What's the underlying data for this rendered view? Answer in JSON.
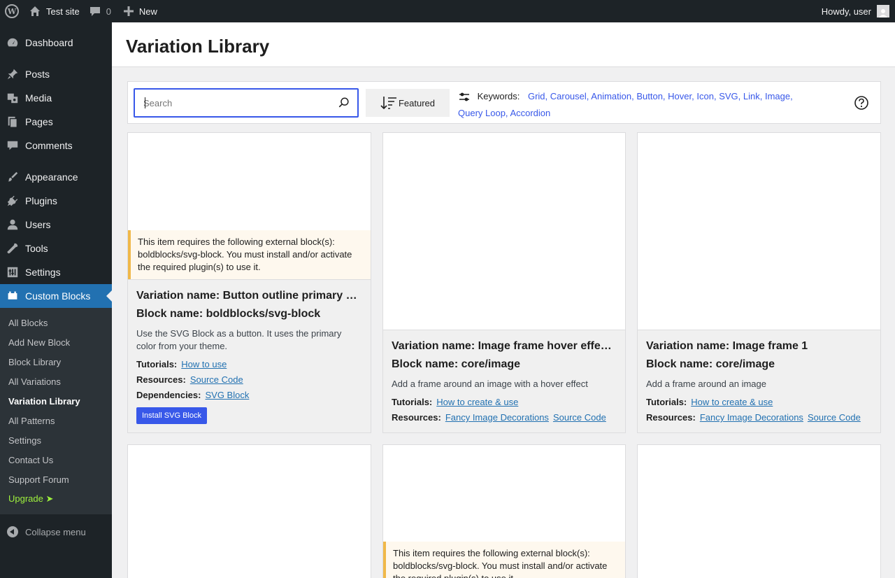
{
  "admin_bar": {
    "site_name": "Test site",
    "comments_count": "0",
    "new_label": "New",
    "greeting": "Howdy, user"
  },
  "sidebar": {
    "menu": [
      {
        "label": "Dashboard",
        "icon": "dashboard-icon"
      },
      {
        "label": "Posts",
        "icon": "pin-icon"
      },
      {
        "label": "Media",
        "icon": "media-icon"
      },
      {
        "label": "Pages",
        "icon": "pages-icon"
      },
      {
        "label": "Comments",
        "icon": "comment-icon"
      },
      {
        "label": "Appearance",
        "icon": "brush-icon"
      },
      {
        "label": "Plugins",
        "icon": "plug-icon"
      },
      {
        "label": "Users",
        "icon": "user-icon"
      },
      {
        "label": "Tools",
        "icon": "wrench-icon"
      },
      {
        "label": "Settings",
        "icon": "sliders-icon"
      },
      {
        "label": "Custom Blocks",
        "icon": "blocks-icon"
      }
    ],
    "submenu": [
      {
        "label": "All Blocks"
      },
      {
        "label": "Add New Block"
      },
      {
        "label": "Block Library"
      },
      {
        "label": "All Variations"
      },
      {
        "label": "Variation Library"
      },
      {
        "label": "All Patterns"
      },
      {
        "label": "Settings"
      },
      {
        "label": "Contact Us"
      },
      {
        "label": "Support Forum"
      },
      {
        "label": "Upgrade ➤"
      }
    ],
    "collapse_label": "Collapse menu"
  },
  "page": {
    "title": "Variation Library"
  },
  "toolbar": {
    "search_placeholder": "Search",
    "sort_label": "Featured",
    "keywords_label": "Keywords:",
    "keywords": [
      "Grid,",
      "Carousel,",
      "Animation,",
      "Button,",
      "Hover,",
      "Icon,",
      "SVG,",
      "Link,",
      "Image,",
      "Query Loop,",
      "Accordion"
    ]
  },
  "cards": [
    {
      "notice": "This item requires the following external block(s): boldblocks/svg-block. You must install and/or activate the required plugin(s) to use it.",
      "variation_name": "Variation name: Button outline primary …",
      "block_name": "Block name: boldblocks/svg-block",
      "description": "Use the SVG Block as a button. It uses the primary color from your theme.",
      "tutorials_label": "Tutorials:",
      "tutorials": [
        "How to use"
      ],
      "resources_label": "Resources:",
      "resources": [
        "Source Code"
      ],
      "dependencies_label": "Dependencies:",
      "dependencies": [
        "SVG Block"
      ],
      "install_label": "Install SVG Block"
    },
    {
      "variation_name": "Variation name: Image frame hover effe…",
      "block_name": "Block name: core/image",
      "description": "Add a frame around an image with a hover effect",
      "tutorials_label": "Tutorials:",
      "tutorials": [
        "How to create & use"
      ],
      "resources_label": "Resources:",
      "resources": [
        "Fancy Image Decorations",
        "Source Code"
      ]
    },
    {
      "variation_name": "Variation name: Image frame 1",
      "block_name": "Block name: core/image",
      "description": "Add a frame around an image",
      "tutorials_label": "Tutorials:",
      "tutorials": [
        "How to create & use"
      ],
      "resources_label": "Resources:",
      "resources": [
        "Fancy Image Decorations",
        "Source Code"
      ]
    },
    {},
    {
      "notice": "This item requires the following external block(s): boldblocks/svg-block. You must install and/or activate the required plugin(s) to use it."
    },
    {}
  ],
  "colors": {
    "admin_bg": "#1d2327",
    "accent": "#2271b1",
    "brand_blue": "#3858e9",
    "notice_border": "#f0b849",
    "upgrade": "#9ff23d"
  }
}
